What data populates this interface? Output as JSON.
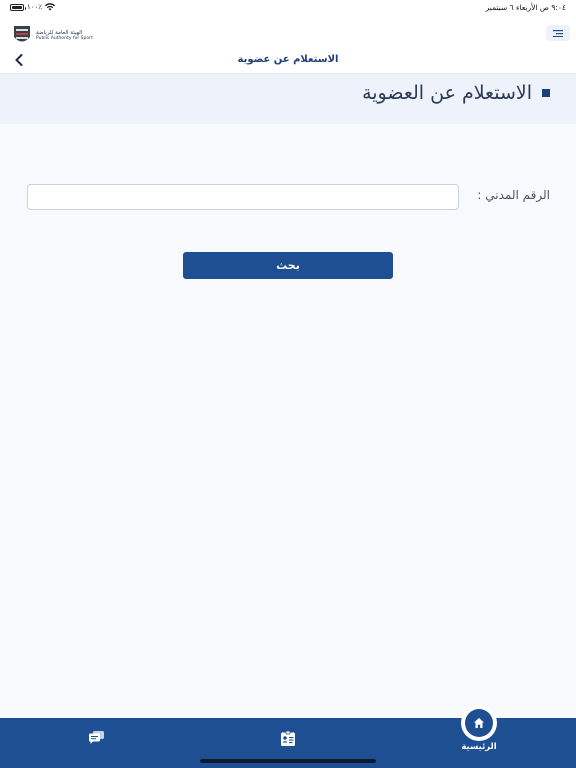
{
  "status_bar": {
    "battery": "١٠٠٪",
    "datetime": "٩:٠٤ ص   الأربعاء ٦ سبتمبر"
  },
  "header": {
    "logo_ar": "الهيئة العامة للرياضة",
    "logo_en": "Public Authority for Sport",
    "title": "الاستعلام عن عضوية"
  },
  "section": {
    "title": "الاستعلام عن العضوية"
  },
  "form": {
    "civil_label": "الرقم المدني :",
    "civil_value": "",
    "search_label": "بحث"
  },
  "bottom_nav": {
    "home_label": "الرئيسية"
  },
  "colors": {
    "primary": "#1f4f93",
    "background": "#f8f9fc",
    "band": "#eef3fb"
  },
  "icons": [
    "wifi-icon",
    "battery-icon",
    "menu-icon",
    "chevron-left-icon",
    "home-icon",
    "chat-icon",
    "id-card-icon"
  ]
}
